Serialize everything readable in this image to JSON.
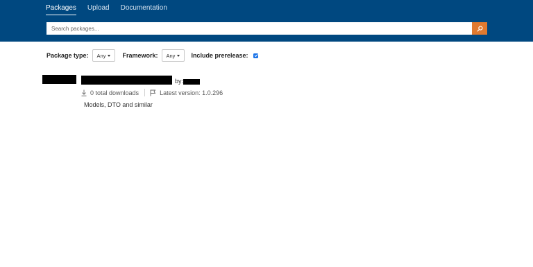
{
  "header": {
    "nav": [
      {
        "label": "Packages",
        "active": true
      },
      {
        "label": "Upload",
        "active": false
      },
      {
        "label": "Documentation",
        "active": false
      }
    ],
    "search_placeholder": "Search packages...",
    "search_icon": "search-icon",
    "accent_color": "#004880",
    "search_button_color": "#e07a30"
  },
  "filters": {
    "package_type_label": "Package type:",
    "package_type_value": "Any",
    "framework_label": "Framework:",
    "framework_value": "Any",
    "prerelease_label": "Include prerelease:",
    "prerelease_checked": true
  },
  "result": {
    "by_label": "by:",
    "downloads": "0 total downloads",
    "latest_version": "Latest version: 1.0.296",
    "description": "Models, DTO and similar"
  }
}
